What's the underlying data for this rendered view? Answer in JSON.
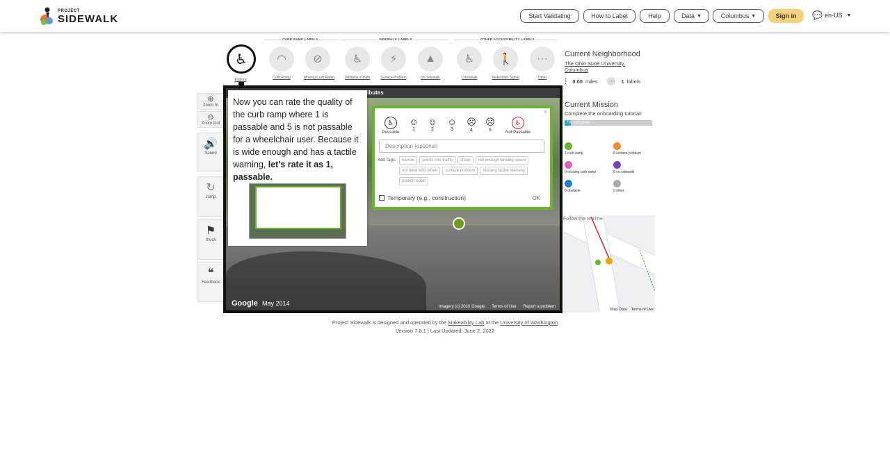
{
  "header": {
    "logo_small": "PROJECT",
    "logo_main": "SIDEWALK",
    "buttons": [
      "Start Validating",
      "How to Label",
      "Help",
      "Data",
      "Columbus"
    ],
    "signin": "Sign in",
    "lang": "en-US"
  },
  "toolbar": {
    "groups": [
      "CURB RAMP LABELS",
      "SIDEWALK LABELS",
      "OTHER ACCESSIBILITY LABELS"
    ],
    "tools": [
      "Explore",
      "Curb Ramp",
      "Missing Curb Ramp",
      "Obstacle in Path",
      "Surface Problem",
      "No Sidewalk",
      "Crosswalk",
      "Pedestrian Signal",
      "Other"
    ]
  },
  "left_controls": {
    "zoom_in": "Zoom In",
    "zoom_out": "Zoom Out",
    "sound": "Sound",
    "jump": "Jump",
    "stuck": "Stuck",
    "feedback": "Feedback"
  },
  "tutorial": {
    "text": "Now you can rate the quality of the curb ramp where 1 is passable and 5 is not passable for a wheelchair user. Because it is wide enough and has a tactile warning,",
    "bold": "let's rate it as 1, passable."
  },
  "pano": {
    "bar": "ributes",
    "google": "Google",
    "date": "May 2014",
    "imagery": "Imagery (c) 2010 Google",
    "terms": "Terms of Use",
    "report": "Report a problem"
  },
  "rating": {
    "passable": "Passable",
    "not_passable": "Not Passable",
    "scores": [
      "1",
      "2",
      "3",
      "4",
      "5"
    ],
    "description_placeholder": "Description (optional)",
    "tags_label": "Add Tags:",
    "tags": [
      "narrow",
      "points into traffic",
      "steep",
      "not enough landing space",
      "not level with street",
      "surface problem",
      "missing tactile warning",
      "pooled water"
    ],
    "temporary": "Temporary (e.g., construction)",
    "ok": "OK",
    "close": "×"
  },
  "sidebar": {
    "neighborhood_title": "Current Neighborhood",
    "neighborhood": "The Ohio State University, Columbus",
    "miles": "0.00",
    "miles_unit": "miles",
    "labels_count": "1",
    "labels_unit": "labels",
    "mission_title": "Current Mission",
    "mission_text": "Complete the onboarding tutorial!",
    "progress_text": "7% complete",
    "progress_value": 0.07,
    "counts": [
      {
        "label": "1 curb ramp",
        "color": "#6ab42e"
      },
      {
        "label": "0 surface problem",
        "color": "#f08a2a"
      },
      {
        "label": "0 missing curb ramp",
        "color": "#d85fc6"
      },
      {
        "label": "0 no sidewalk",
        "color": "#7b3fb8"
      },
      {
        "label": "0 obstacle",
        "color": "#1f7fd6"
      },
      {
        "label": "0 other",
        "color": "#aaaaaa"
      }
    ],
    "map_hint": "Follow the red line",
    "map_data": "Map Data",
    "map_terms": "Terms of Use"
  },
  "footer": {
    "line1_a": "Project Sidewalk is designed and operated by the",
    "lab": "Makeability Lab",
    "line1_b": "at the",
    "uni": "University of Washington",
    "line2": "Version 7.6.1 | Last Updated: June 2, 2022"
  }
}
